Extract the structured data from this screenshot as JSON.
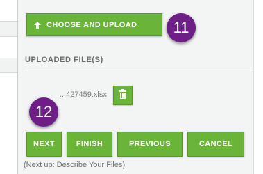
{
  "upload": {
    "button_label": "CHOOSE AND UPLOAD",
    "icon": "upload-arrow-icon"
  },
  "callouts": {
    "step_11": "11",
    "step_12": "12"
  },
  "uploaded_section": {
    "heading": "UPLOADED FILE(S)",
    "file_name": "...427459.xlsx",
    "delete_icon": "trash-icon"
  },
  "navigation": {
    "next_label": "NEXT",
    "finish_label": "FINISH",
    "previous_label": "PREVIOUS",
    "cancel_label": "CANCEL",
    "next_up_text": "(Next up: Describe Your Files)"
  },
  "colors": {
    "button_green": "#6ab437",
    "badge_purple": "#6d1f87",
    "panel_bg": "#f3f4f4"
  }
}
